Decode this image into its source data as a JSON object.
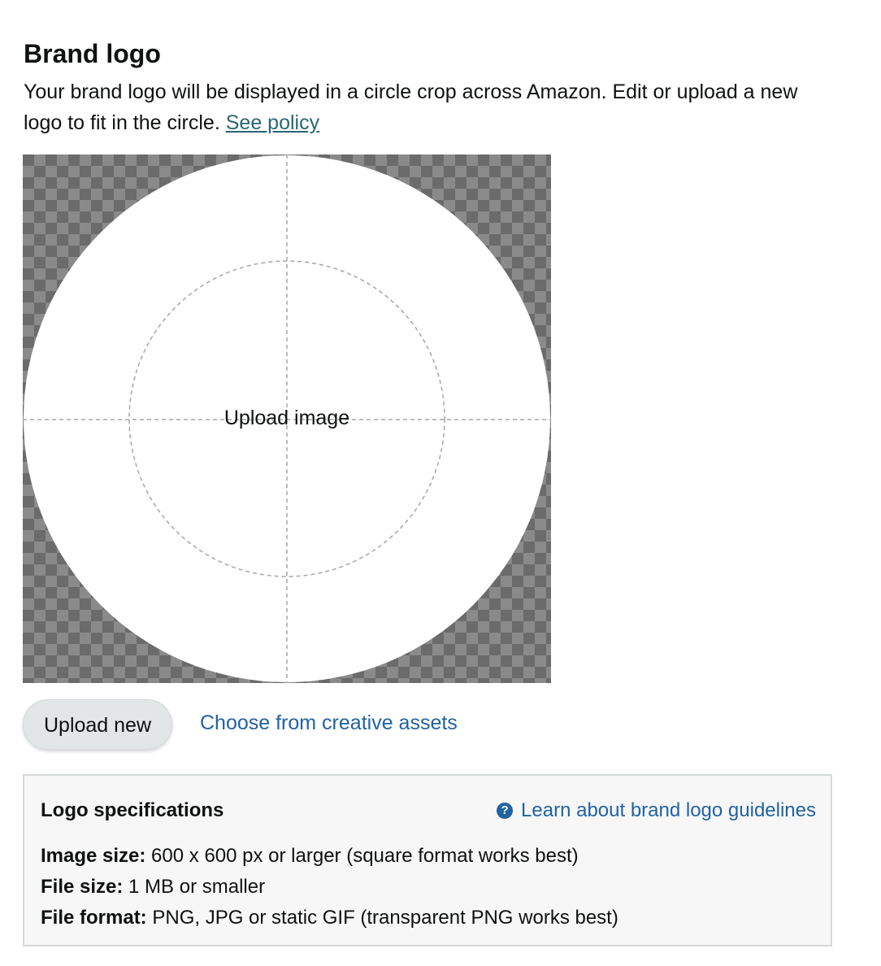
{
  "section": {
    "title": "Brand logo",
    "description": "Your brand logo will be displayed in a circle crop across Amazon. Edit or upload a new logo to fit in the circle.",
    "policy_link": "See policy"
  },
  "upload_area": {
    "label": "Upload image"
  },
  "actions": {
    "upload_new": "Upload new",
    "choose_assets": "Choose from creative assets"
  },
  "specs": {
    "title": "Logo specifications",
    "guidelines_link": "Learn about brand logo guidelines",
    "help_icon": "?",
    "items": [
      {
        "key": "Image size:",
        "value": " 600 x 600 px or larger (square format works best)"
      },
      {
        "key": "File size:",
        "value": " 1 MB or smaller"
      },
      {
        "key": "File format:",
        "value": " PNG, JPG or static GIF (transparent PNG works best)"
      }
    ]
  },
  "colors": {
    "link": "#2162a1",
    "policy_link": "#2a6673",
    "checker_dark": "#6b6b6b",
    "checker_light": "#8a8a8a",
    "guide_lines": "#a6a6a6"
  }
}
